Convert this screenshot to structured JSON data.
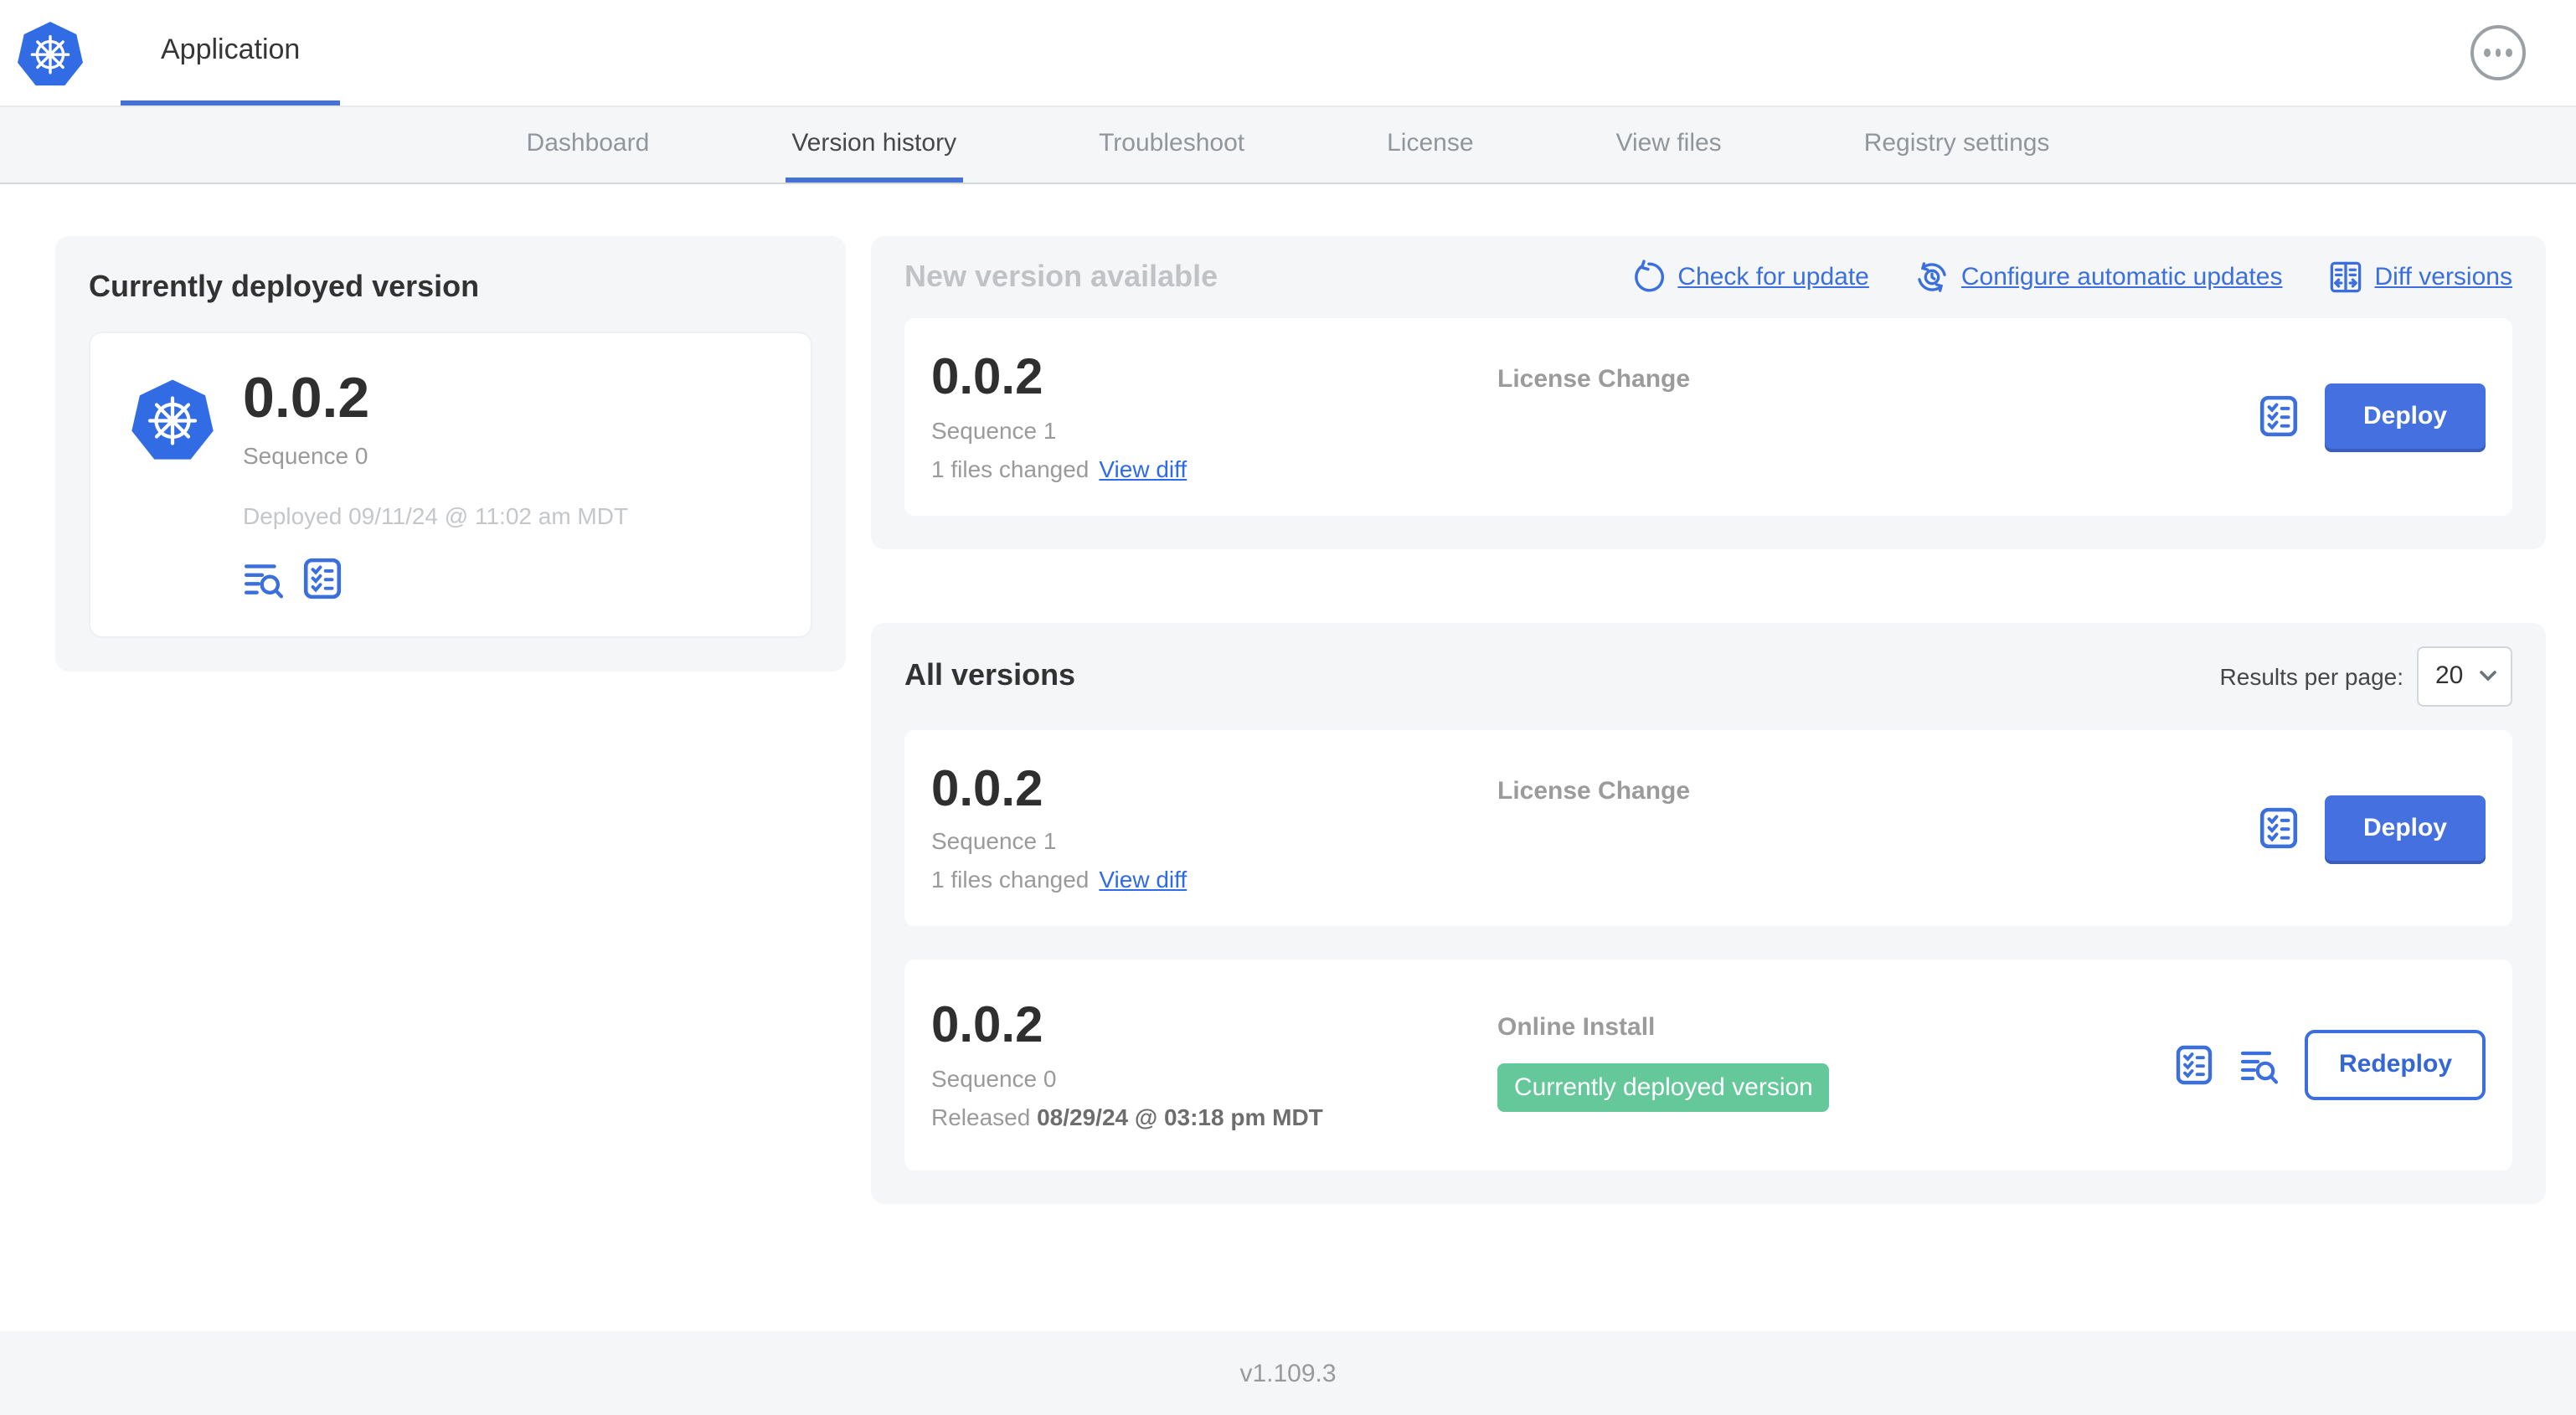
{
  "header": {
    "app_title": "Application",
    "ellipsis_menu": "more-options"
  },
  "nav": {
    "tabs": [
      {
        "label": "Dashboard",
        "active": false
      },
      {
        "label": "Version history",
        "active": true
      },
      {
        "label": "Troubleshoot",
        "active": false
      },
      {
        "label": "License",
        "active": false
      },
      {
        "label": "View files",
        "active": false
      },
      {
        "label": "Registry settings",
        "active": false
      }
    ]
  },
  "current_version_panel": {
    "title": "Currently deployed version",
    "version": "0.0.2",
    "sequence": "Sequence 0",
    "deployed": "Deployed 09/11/24 @ 11:02 am MDT"
  },
  "new_version_panel": {
    "title": "New version available",
    "links": {
      "check_for_update": "Check for update",
      "configure_automatic_updates": "Configure automatic updates",
      "diff_versions": "Diff versions"
    },
    "row": {
      "version": "0.0.2",
      "sequence": "Sequence 1",
      "files_changed": "1 files changed",
      "view_diff": "View diff",
      "source": "License Change",
      "action": "Deploy"
    }
  },
  "all_versions_panel": {
    "title": "All versions",
    "results_per_page_label": "Results per page:",
    "results_per_page_value": "20",
    "rows": [
      {
        "version": "0.0.2",
        "sequence": "Sequence 1",
        "files_changed": "1 files changed",
        "view_diff": "View diff",
        "source": "License Change",
        "action": "Deploy"
      },
      {
        "version": "0.0.2",
        "sequence": "Sequence 0",
        "released_prefix": "Released",
        "released_date": "08/29/24 @ 03:18 pm MDT",
        "source": "Online Install",
        "badge": "Currently deployed version",
        "action": "Redeploy"
      }
    ]
  },
  "footer": {
    "version": "v1.109.3"
  },
  "colors": {
    "accent_blue": "#3b6fdd",
    "button_blue": "#4570e0",
    "active_tab_blue": "#4673d1",
    "badge_green": "#65c89b",
    "panel_gray": "#f4f6f8",
    "kubernetes_blue": "#326ce5"
  }
}
